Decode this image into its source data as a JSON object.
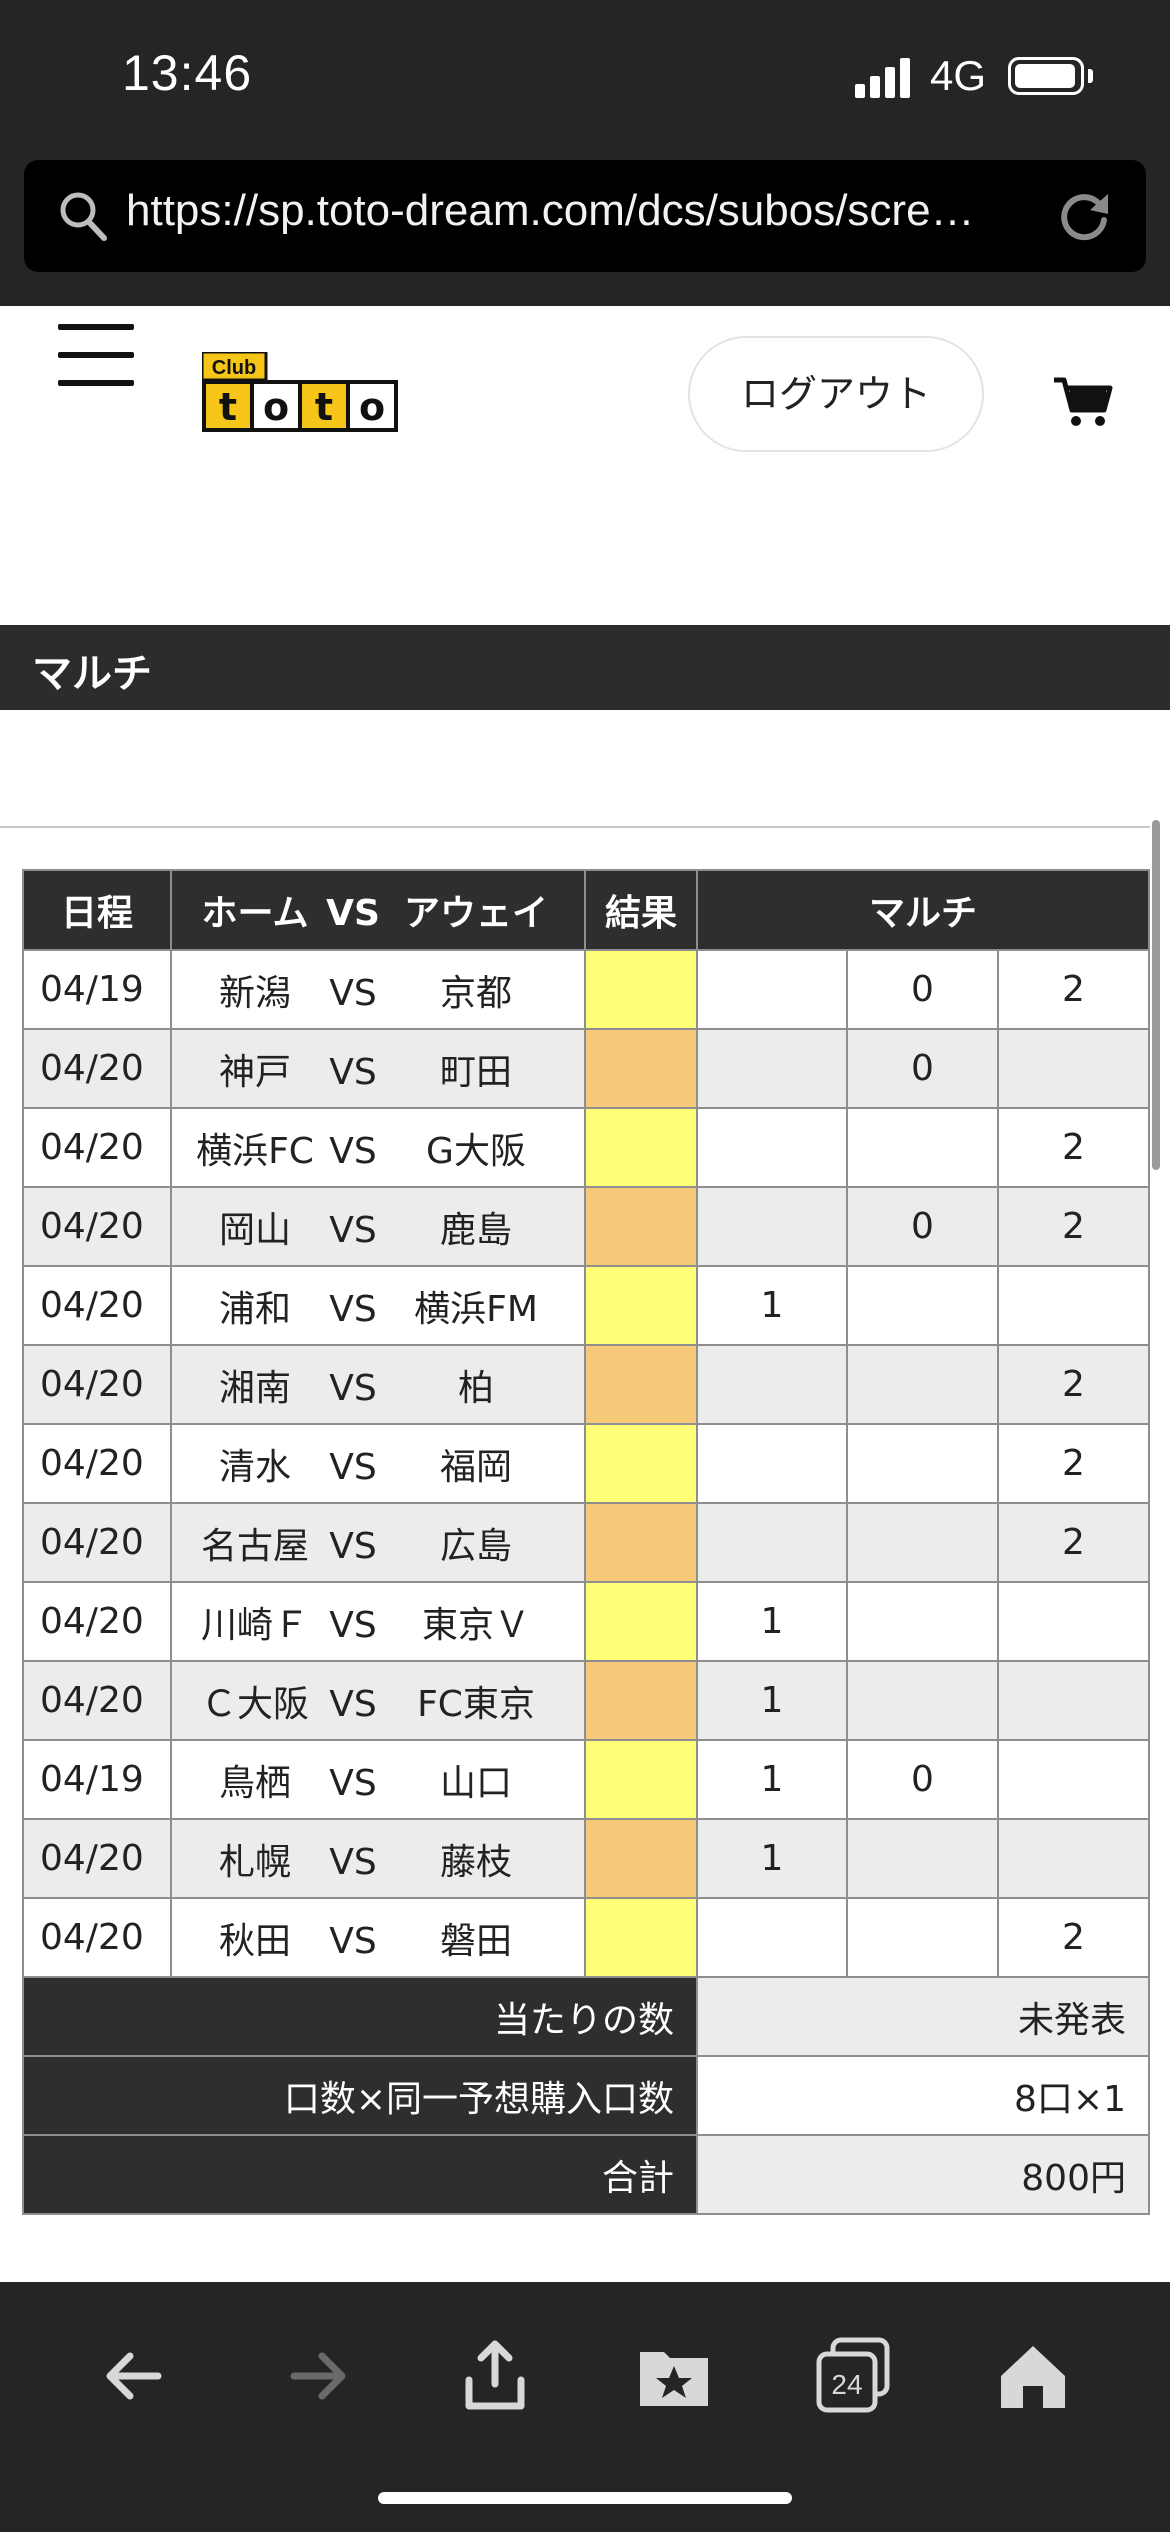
{
  "status_bar": {
    "time": "13:46",
    "network": "4G"
  },
  "browser": {
    "url": "https://sp.toto-dream.com/dcs/subos/scre…",
    "tab_count": "24"
  },
  "header": {
    "logo_small": "Club",
    "logo_big": "toto",
    "logout_label": "ログアウト"
  },
  "section": {
    "title": "マルチ"
  },
  "table": {
    "headers": {
      "date": "日程",
      "home": "ホーム",
      "vs": "VS",
      "away": "アウェイ",
      "result": "結果",
      "multi": "マルチ"
    },
    "rows": [
      {
        "date": "04/19",
        "home": "新潟",
        "vs": "VS",
        "away": "京都",
        "m1": "",
        "m0": "0",
        "m2": "2"
      },
      {
        "date": "04/20",
        "home": "神戸",
        "vs": "VS",
        "away": "町田",
        "m1": "",
        "m0": "0",
        "m2": ""
      },
      {
        "date": "04/20",
        "home": "横浜FC",
        "vs": "VS",
        "away": "G大阪",
        "m1": "",
        "m0": "",
        "m2": "2"
      },
      {
        "date": "04/20",
        "home": "岡山",
        "vs": "VS",
        "away": "鹿島",
        "m1": "",
        "m0": "0",
        "m2": "2"
      },
      {
        "date": "04/20",
        "home": "浦和",
        "vs": "VS",
        "away": "横浜FM",
        "m1": "1",
        "m0": "",
        "m2": ""
      },
      {
        "date": "04/20",
        "home": "湘南",
        "vs": "VS",
        "away": "柏",
        "m1": "",
        "m0": "",
        "m2": "2"
      },
      {
        "date": "04/20",
        "home": "清水",
        "vs": "VS",
        "away": "福岡",
        "m1": "",
        "m0": "",
        "m2": "2"
      },
      {
        "date": "04/20",
        "home": "名古屋",
        "vs": "VS",
        "away": "広島",
        "m1": "",
        "m0": "",
        "m2": "2"
      },
      {
        "date": "04/20",
        "home": "川崎Ｆ",
        "vs": "VS",
        "away": "東京Ｖ",
        "m1": "1",
        "m0": "",
        "m2": ""
      },
      {
        "date": "04/20",
        "home": "Ｃ大阪",
        "vs": "VS",
        "away": "FC東京",
        "m1": "1",
        "m0": "",
        "m2": ""
      },
      {
        "date": "04/19",
        "home": "鳥栖",
        "vs": "VS",
        "away": "山口",
        "m1": "1",
        "m0": "0",
        "m2": ""
      },
      {
        "date": "04/20",
        "home": "札幌",
        "vs": "VS",
        "away": "藤枝",
        "m1": "1",
        "m0": "",
        "m2": ""
      },
      {
        "date": "04/20",
        "home": "秋田",
        "vs": "VS",
        "away": "磐田",
        "m1": "",
        "m0": "",
        "m2": "2"
      }
    ],
    "summary": {
      "hits_label": "当たりの数",
      "hits_value": "未発表",
      "units_label": "口数×同一予想購入口数",
      "units_value": "8口×1",
      "total_label": "合計",
      "total_value": "800円"
    }
  },
  "colors": {
    "result_yellow": "#ffff77",
    "result_orange": "#f6c978",
    "dark_bar": "#2c2c2c",
    "logo_yellow": "#f5c518"
  },
  "icons": [
    "search-icon",
    "reload-icon",
    "hamburger-icon",
    "cart-icon",
    "back-icon",
    "forward-icon",
    "share-icon",
    "bookmarks-icon",
    "tabs-icon",
    "home-icon"
  ]
}
